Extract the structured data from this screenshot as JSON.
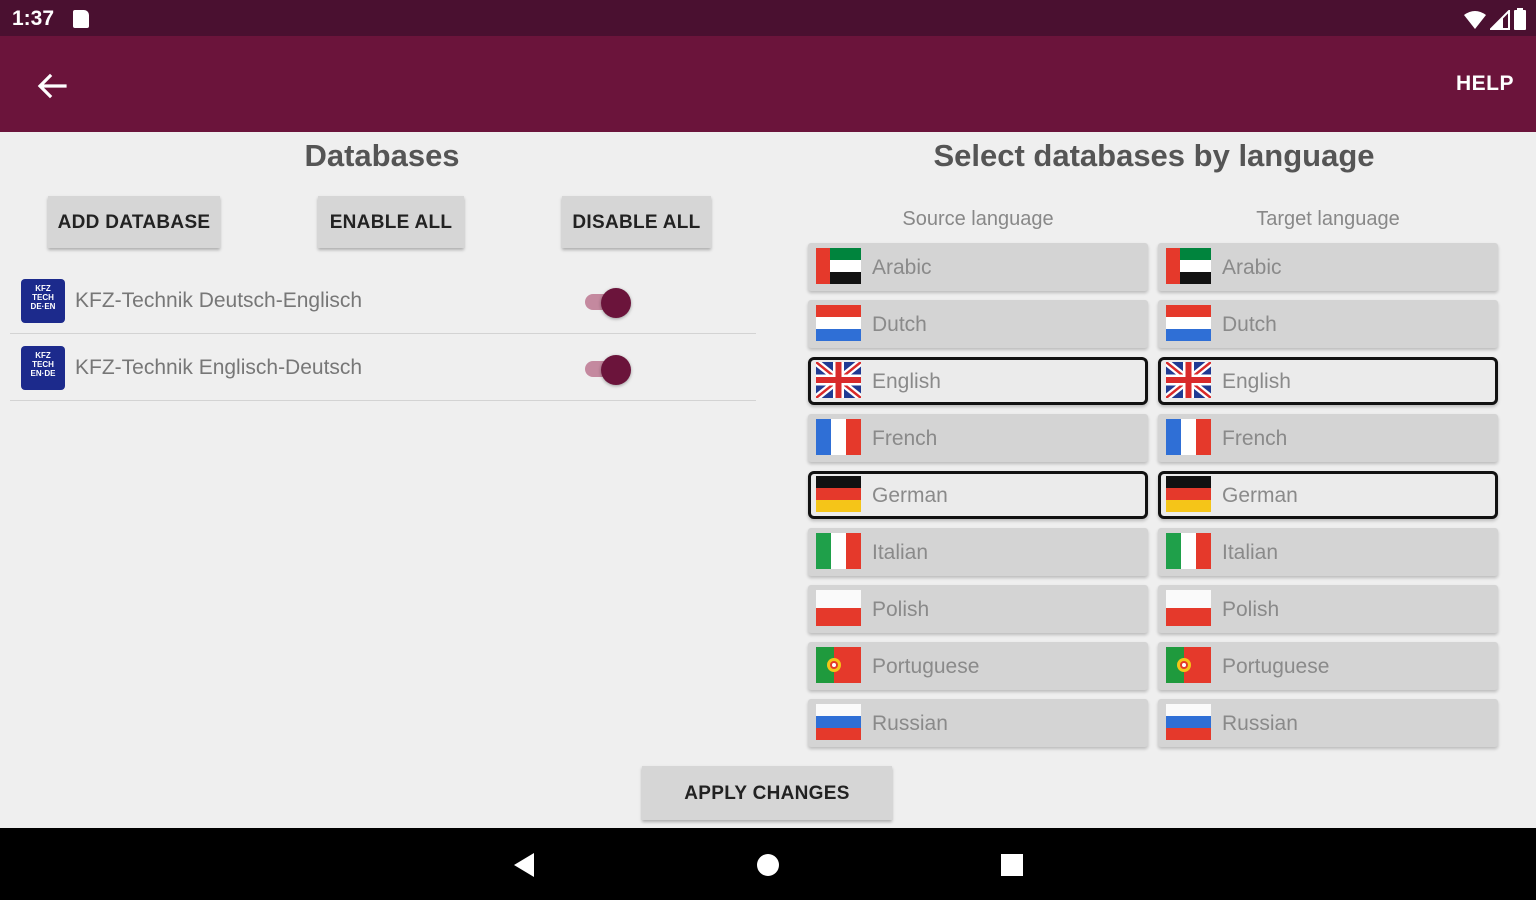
{
  "status_bar": {
    "time": "1:37"
  },
  "app_bar": {
    "help_label": "HELP"
  },
  "databases": {
    "title": "Databases",
    "add_label": "ADD DATABASE",
    "enable_all_label": "ENABLE ALL",
    "disable_all_label": "DISABLE ALL",
    "items": [
      {
        "label": "KFZ-Technik Deutsch-Englisch",
        "enabled": true
      },
      {
        "label": "KFZ-Technik Englisch-Deutsch",
        "enabled": true
      }
    ]
  },
  "language_select": {
    "title": "Select databases by language",
    "source_header": "Source language",
    "target_header": "Target language",
    "source": [
      {
        "label": "Arabic",
        "flag": "ae-flag-icon",
        "selected": false
      },
      {
        "label": "Dutch",
        "flag": "nl-flag-icon",
        "selected": false
      },
      {
        "label": "English",
        "flag": "uk-flag-icon",
        "selected": true
      },
      {
        "label": "French",
        "flag": "fr-flag-icon",
        "selected": false
      },
      {
        "label": "German",
        "flag": "de-flag-icon",
        "selected": true
      },
      {
        "label": "Italian",
        "flag": "it-flag-icon",
        "selected": false
      },
      {
        "label": "Polish",
        "flag": "pl-flag-icon",
        "selected": false
      },
      {
        "label": "Portuguese",
        "flag": "pt-flag-icon",
        "selected": false
      },
      {
        "label": "Russian",
        "flag": "ru-flag-icon",
        "selected": false
      }
    ],
    "target": [
      {
        "label": "Arabic",
        "flag": "ae-flag-icon",
        "selected": false
      },
      {
        "label": "Dutch",
        "flag": "nl-flag-icon",
        "selected": false
      },
      {
        "label": "English",
        "flag": "uk-flag-icon",
        "selected": true
      },
      {
        "label": "French",
        "flag": "fr-flag-icon",
        "selected": false
      },
      {
        "label": "German",
        "flag": "de-flag-icon",
        "selected": true
      },
      {
        "label": "Italian",
        "flag": "it-flag-icon",
        "selected": false
      },
      {
        "label": "Polish",
        "flag": "pl-flag-icon",
        "selected": false
      },
      {
        "label": "Portuguese",
        "flag": "pt-flag-icon",
        "selected": false
      },
      {
        "label": "Russian",
        "flag": "ru-flag-icon",
        "selected": false
      }
    ]
  },
  "apply_label": "APPLY CHANGES",
  "colors": {
    "primary": "#6b143b",
    "status_bar": "#4a1030",
    "accent_track": "#c4899f"
  }
}
